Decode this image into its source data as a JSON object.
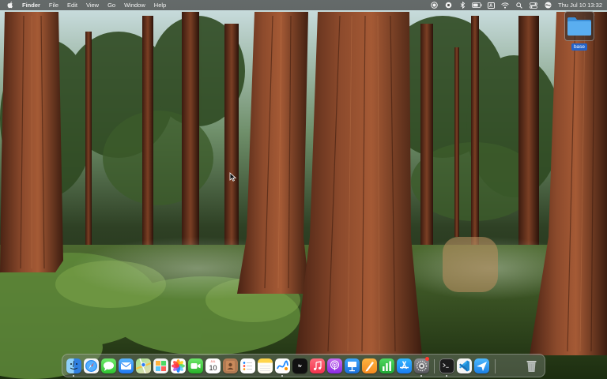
{
  "menubar": {
    "app_name": "Finder",
    "menus": [
      "File",
      "Edit",
      "View",
      "Go",
      "Window",
      "Help"
    ],
    "input_source": "A",
    "clock": "Thu Jul 10  13:32"
  },
  "desktop": {
    "folder_name": "base"
  },
  "dock": {
    "apps": [
      "finder",
      "safari",
      "messages",
      "mail",
      "maps",
      "photos-app",
      "photos",
      "facetime",
      "calendar",
      "contacts",
      "reminders",
      "notes",
      "freeform",
      "apple-tv",
      "music",
      "podcasts",
      "keynote",
      "pages",
      "numbers",
      "app-store",
      "system-settings",
      "terminal",
      "vs-code",
      "testflight",
      "trash"
    ],
    "calendar_month": "JUL",
    "calendar_day": "10",
    "tv_label": "tv"
  },
  "colors": {
    "menubar_bg": "#3c3c3a",
    "selection_blue": "#2463c9",
    "folder_blue": "#5aaef0"
  }
}
